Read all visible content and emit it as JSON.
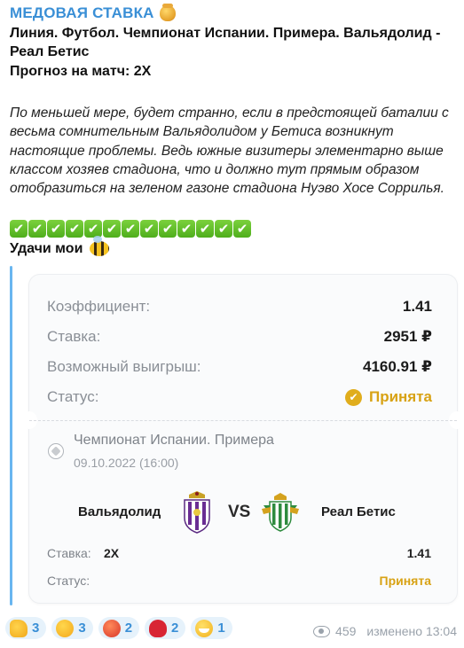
{
  "channel": {
    "title": "МЕДОВАЯ СТАВКА",
    "title_icon": "honey-pot-icon"
  },
  "post": {
    "line1": "Линия. Футбол. Чемпионат Испании. Примера. Вальядолид -",
    "line2": "Реал Бетис",
    "forecast": "Прогноз на матч: 2Х",
    "paragraph": "По меньшей мере, будет странно, если в предстоящей баталии с весьма сомнительным Вальядолидом у Бетиса возникнут настоящие проблемы. Ведь южные визитеры элементарно выше классом хозяев стадиона, что и должно тут прямым образом отобразиться на зеленом газоне стадиона Нуэво Хосе Соррилья.",
    "check_count": 13,
    "check_glyph": "✔",
    "luck": "Удачи мои",
    "luck_icon": "bee-icon"
  },
  "bet_card": {
    "rows": [
      {
        "label": "Коэффициент:",
        "value": "1.41"
      },
      {
        "label": "Ставка:",
        "value": "2951 ₽"
      },
      {
        "label": "Возможный выигрыш:",
        "value": "4160.91 ₽"
      }
    ],
    "status_label": "Статус:",
    "status_value": "Принята",
    "league": "Чемпионат Испании. Примера",
    "datetime": "09.10.2022 (16:00)",
    "home_team": "Вальядолид",
    "vs": "VS",
    "away_team": "Реал Бетис",
    "stake_label": "Ставка:",
    "stake_value": "2Х",
    "stake_odds": "1.41",
    "mini_status_label": "Статус:",
    "mini_status_value": "Принята"
  },
  "reactions": [
    {
      "icon": "thumbs-up-icon",
      "count": "3"
    },
    {
      "icon": "thinking-face-icon",
      "count": "3"
    },
    {
      "icon": "angry-face-icon",
      "count": "2"
    },
    {
      "icon": "heart-icon",
      "count": "2"
    },
    {
      "icon": "grinning-face-icon",
      "count": "1"
    }
  ],
  "meta": {
    "views": "459",
    "edited": "изменено 13:04"
  },
  "colors": {
    "accent": "#3a8fd6",
    "status": "#d8a214",
    "quote_bar": "#69b6f0"
  }
}
